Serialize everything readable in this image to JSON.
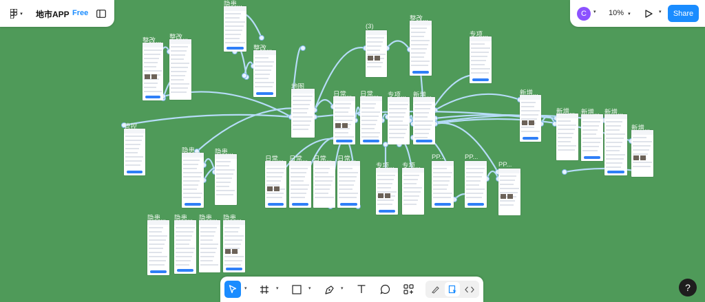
{
  "file": {
    "title": "地市APP",
    "plan_badge": "Free"
  },
  "header_right": {
    "avatar_initial": "C",
    "zoom": "10%",
    "share_label": "Share"
  },
  "help": {
    "label": "?"
  },
  "colors": {
    "canvas": "#4f9a59",
    "accent": "#1a8cff",
    "avatar": "#8c52ff",
    "connector": "#b6dcf8"
  },
  "toolbar": {
    "tools": [
      "move-tool",
      "frame-tool",
      "shape-tool",
      "pen-tool",
      "text-tool",
      "comment-tool",
      "actions-tool"
    ],
    "modes": [
      "draw-mode",
      "design-mode",
      "dev-mode"
    ]
  },
  "frames": [
    {
      "label": "整改..."
    },
    {
      "label": "整改..."
    },
    {
      "label": "隐患..."
    },
    {
      "label": "整改..."
    },
    {
      "label": "(3)"
    },
    {
      "label": "整改..."
    },
    {
      "label": "专项..."
    },
    {
      "label": "地图"
    },
    {
      "label": "日常..."
    },
    {
      "label": "日常..."
    },
    {
      "label": "专项..."
    },
    {
      "label": "新增..."
    },
    {
      "label": "新增..."
    },
    {
      "label": "新增..."
    },
    {
      "label": "新增..."
    },
    {
      "label": "新增..."
    },
    {
      "label": "新增..."
    },
    {
      "label": "管控"
    },
    {
      "label": "隐患..."
    },
    {
      "label": "隐患..."
    },
    {
      "label": "日常..."
    },
    {
      "label": "日常..."
    },
    {
      "label": "日常..."
    },
    {
      "label": "日常..."
    },
    {
      "label": "专项..."
    },
    {
      "label": "专项..."
    },
    {
      "label": "PP..."
    },
    {
      "label": "PP..."
    },
    {
      "label": "PP..."
    },
    {
      "label": "隐患..."
    },
    {
      "label": "隐患..."
    },
    {
      "label": "隐患..."
    },
    {
      "label": "隐患..."
    }
  ]
}
